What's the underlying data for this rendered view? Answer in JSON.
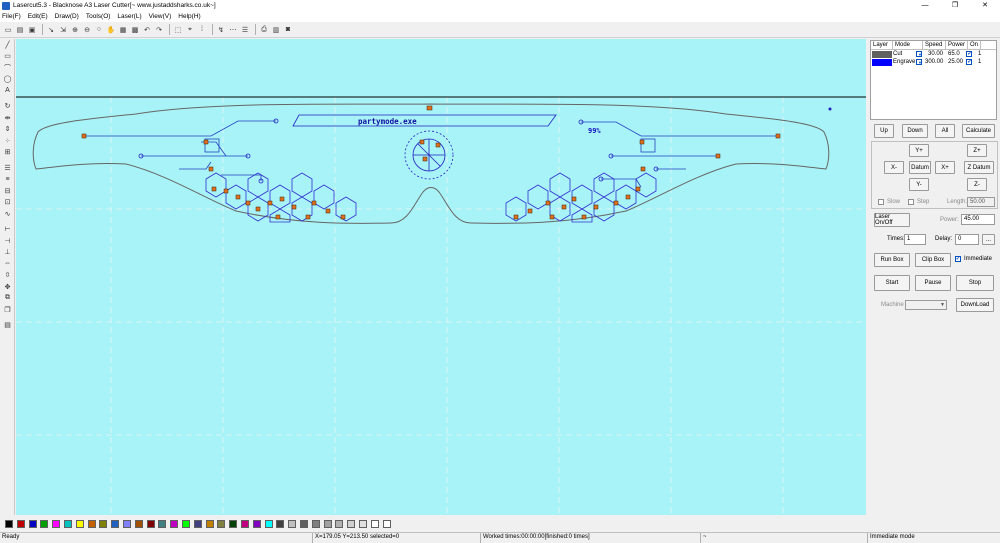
{
  "window": {
    "title": "Lasercut5.3 - Blacknose A3 Laser Cutter[~ www.justaddsharks.co.uk~]",
    "controls": [
      "—",
      "❐",
      "✕"
    ]
  },
  "menu": [
    "File(F)",
    "Edit(E)",
    "Draw(D)",
    "Tools(O)",
    "Laser(L)",
    "View(V)",
    "Help(H)"
  ],
  "canvas": {
    "background": "#a8f3f7",
    "text_partymode": "partymode.exe",
    "text_percent": "99%"
  },
  "layers": {
    "headers": [
      "Layer",
      "Mode",
      "Speed",
      "Power",
      "On",
      ""
    ],
    "rows": [
      {
        "color": "#606060",
        "mode": "Cut",
        "speed": "30.00",
        "power": "65.0",
        "count": "1"
      },
      {
        "color": "#0000ff",
        "mode": "Engrave",
        "speed": "300.00",
        "power": "25.00",
        "count": "1"
      }
    ]
  },
  "panel": {
    "up": "Up",
    "down": "Down",
    "all": "All",
    "calculate": "Calculate",
    "y_plus": "Y+",
    "z_plus": "Z+",
    "x_minus": "X-",
    "datum": "Datum",
    "x_plus": "X+",
    "z_datum": "Z Datum",
    "y_minus": "Y-",
    "z_minus": "Z-",
    "slow": "Slow",
    "step": "Step",
    "length_label": "Length:",
    "length_value": "50.00",
    "laser_onoff": "Laser On/Off",
    "power_label": "Power:",
    "power_value": "45.00",
    "times_label": "Times:",
    "times_value": "1",
    "delay_label": "Delay:",
    "delay_value": "0",
    "ellipsis": "...",
    "run_box": "Run Box",
    "clip_box": "Clip Box",
    "immediate": "Immediate",
    "start": "Start",
    "pause": "Pause",
    "stop": "Stop",
    "machine_label": "Machine",
    "download": "DownLoad"
  },
  "palette": [
    "#000000",
    "#c00000",
    "#0000c0",
    "#00a000",
    "#ff00ff",
    "#00c0c0",
    "#ffff00",
    "#c06000",
    "#808000",
    "#2060c0",
    "#8080ff",
    "#a05000",
    "#800000",
    "#408080",
    "#c000c0",
    "#00ff00",
    "#404080",
    "#c08000",
    "#808040",
    "#004000",
    "#c00080",
    "#8000c0",
    "#00ffff",
    "#404040",
    "#c0c0c0",
    "#606060",
    "#808080",
    "#a0a0a0",
    "#b0b0b0",
    "#d0d0d0",
    "#e0e0e0",
    "#ffffff",
    "#ffffff"
  ],
  "status": {
    "ready": "Ready",
    "coords": "X=179.05 Y=213.50 selected=0",
    "worked": "Worked times:00:00:00[finished:0 times]",
    "tilde": "~",
    "mode": "Immediate mode"
  }
}
